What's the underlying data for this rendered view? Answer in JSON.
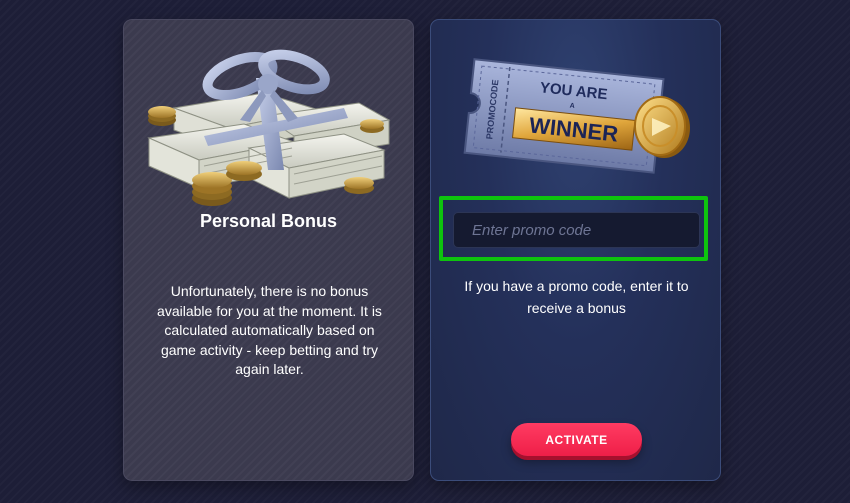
{
  "personal_bonus": {
    "title": "Personal Bonus",
    "description": "Unfortunately, there is no bonus available for you at the moment. It is calculated automatically based on game activity - keep betting and try again later.",
    "image_icon": "gift-money-icon"
  },
  "promo": {
    "ticket": {
      "line1": "YOU ARE",
      "line2": "A",
      "line3": "WINNER",
      "side_label": "PROMOCODE",
      "image_icon": "winner-ticket-icon"
    },
    "input_value": "",
    "input_placeholder": "Enter promo code",
    "hint": "If you have a promo code, enter it to receive a bonus",
    "activate_label": "ACTIVATE"
  },
  "colors": {
    "background": "#1d1e37",
    "left_card": "#3b3a4e",
    "right_card": "#24305a",
    "highlight": "#0ec40e",
    "button": "#f42a52"
  }
}
